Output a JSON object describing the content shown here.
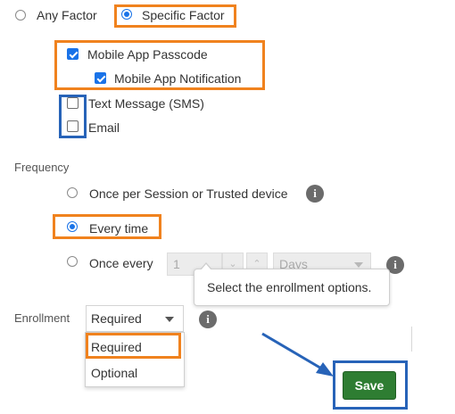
{
  "factor_mode": {
    "any_label": "Any Factor",
    "specific_label": "Specific Factor",
    "selected": "specific"
  },
  "factors": [
    {
      "label": "Mobile App Passcode",
      "checked": true
    },
    {
      "label": "Mobile App Notification",
      "checked": true
    },
    {
      "label": "Text Message (SMS)",
      "checked": false
    },
    {
      "label": "Email",
      "checked": false
    }
  ],
  "frequency": {
    "heading": "Frequency",
    "options": [
      {
        "label": "Once per Session or Trusted device",
        "checked": false
      },
      {
        "label": "Every time",
        "checked": true
      },
      {
        "label": "Once every",
        "checked": false
      }
    ],
    "interval_value": "1",
    "interval_unit": "Days"
  },
  "enrollment": {
    "heading": "Enrollment",
    "selected": "Required",
    "options": [
      "Required",
      "Optional"
    ],
    "tooltip": "Select the enrollment options."
  },
  "actions": {
    "save_label": "Save"
  },
  "colors": {
    "highlight_orange": "#f0821e",
    "highlight_blue": "#2763b8",
    "radio_checked": "#1a73e8",
    "save_button": "#2e7d32"
  },
  "icons": {
    "info": "info-icon",
    "stepper_down": "chevron-down-icon",
    "stepper_up": "chevron-up-icon",
    "arrow": "arrow-pointer-icon"
  }
}
